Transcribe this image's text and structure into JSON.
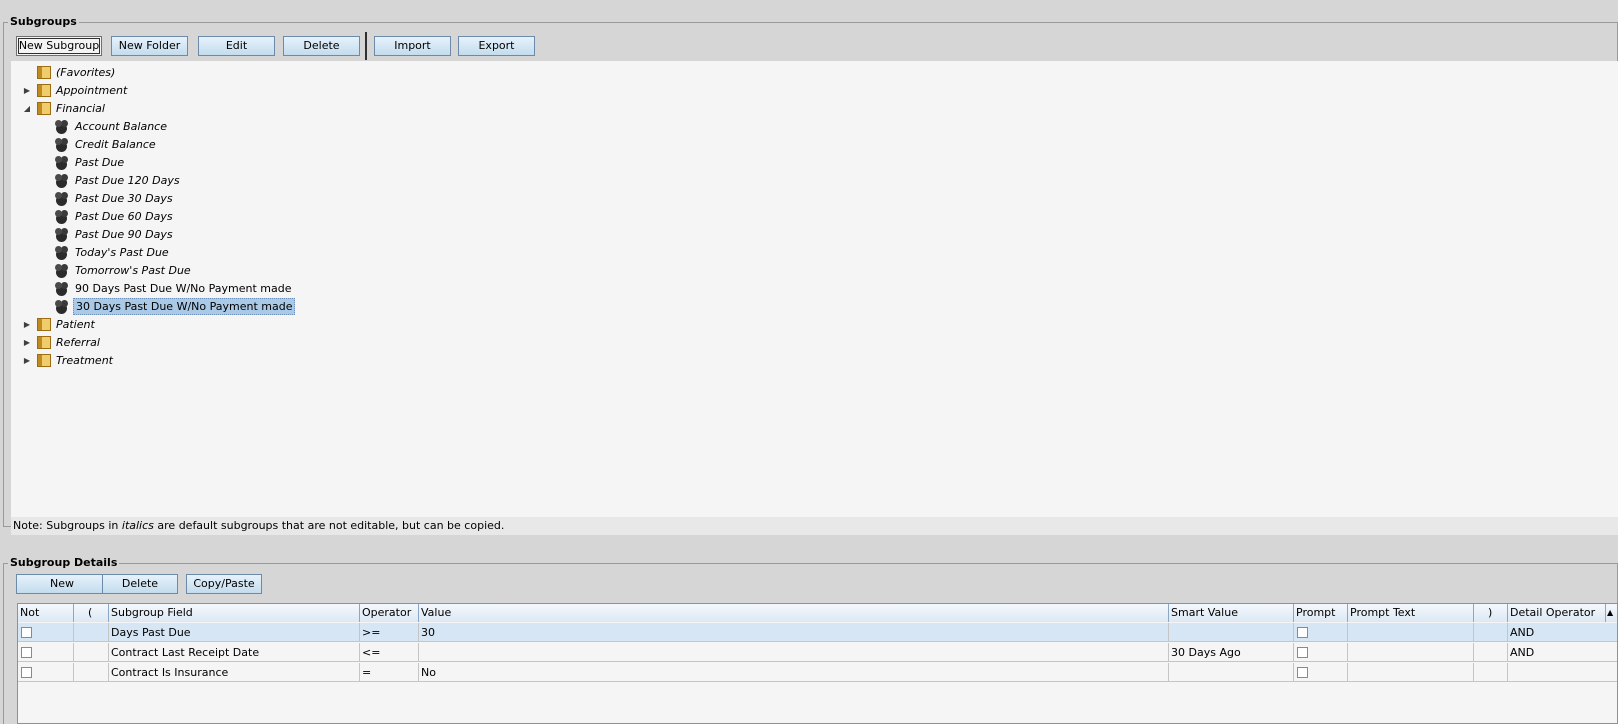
{
  "subgroups": {
    "title": "Subgroups",
    "toolbar": {
      "new_subgroup": "New Subgroup",
      "new_folder": "New Folder",
      "edit": "Edit",
      "delete": "Delete",
      "import": "Import",
      "export": "Export"
    },
    "tree": {
      "favorites": "(Favorites)",
      "appointment": "Appointment",
      "financial": "Financial",
      "financial_items": [
        "Account Balance",
        "Credit Balance",
        "Past Due",
        "Past Due 120 Days",
        "Past Due 30 Days",
        "Past Due 60 Days",
        "Past Due 90 Days",
        "Today's Past Due",
        "Tomorrow's Past Due",
        "90 Days Past Due W/No Payment made",
        "30 Days Past Due W/No Payment made"
      ],
      "patient": "Patient",
      "referral": "Referral",
      "treatment": "Treatment"
    },
    "note": {
      "prefix": "Note: Subgroups in ",
      "italic_word": "italics",
      "suffix": " are default subgroups that are not editable, but can be copied."
    }
  },
  "details": {
    "title": "Subgroup Details",
    "toolbar": {
      "new": "New",
      "delete": "Delete",
      "copy_paste": "Copy/Paste"
    },
    "columns": {
      "not": "Not",
      "open_paren": "(",
      "field": "Subgroup Field",
      "operator": "Operator",
      "value": "Value",
      "smart_value": "Smart Value",
      "prompt": "Prompt",
      "prompt_text": "Prompt Text",
      "close_paren": ")",
      "detail_operator": "Detail Operator"
    },
    "rows": [
      {
        "field": "Days Past Due",
        "operator": ">=",
        "value": "30",
        "smart_value": "",
        "prompt_text": "",
        "detail_operator": "AND"
      },
      {
        "field": "Contract Last Receipt Date",
        "operator": "<=",
        "value": "",
        "smart_value": "30 Days Ago",
        "prompt_text": "",
        "detail_operator": "AND"
      },
      {
        "field": "Contract Is Insurance",
        "operator": "=",
        "value": "No",
        "smart_value": "",
        "prompt_text": "",
        "detail_operator": ""
      }
    ]
  }
}
